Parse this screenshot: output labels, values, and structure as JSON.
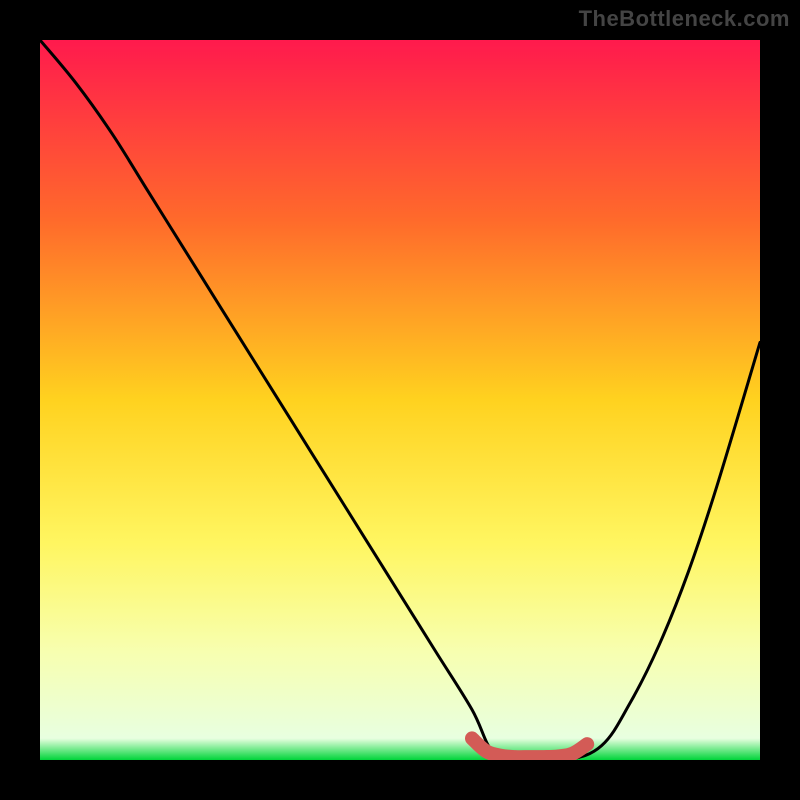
{
  "watermark": "TheBottleneck.com",
  "chart_data": {
    "type": "line",
    "title": "",
    "xlabel": "",
    "ylabel": "",
    "xlim": [
      0,
      100
    ],
    "ylim": [
      0,
      100
    ],
    "grid": false,
    "legend": false,
    "background_gradient_stops": [
      {
        "offset": 0,
        "color": "#ff1a4d"
      },
      {
        "offset": 25,
        "color": "#ff6a2b"
      },
      {
        "offset": 50,
        "color": "#ffd21f"
      },
      {
        "offset": 70,
        "color": "#fff661"
      },
      {
        "offset": 85,
        "color": "#f7ffb0"
      },
      {
        "offset": 97,
        "color": "#e8ffe0"
      },
      {
        "offset": 100,
        "color": "#00d43a"
      }
    ],
    "series": [
      {
        "name": "bottleneck-curve",
        "color": "#000000",
        "x": [
          0,
          5,
          10,
          15,
          20,
          25,
          30,
          35,
          40,
          45,
          50,
          55,
          60,
          63,
          67,
          73,
          78,
          82,
          86,
          90,
          94,
          100
        ],
        "y": [
          100,
          94,
          87,
          79,
          71,
          63,
          55,
          47,
          39,
          31,
          23,
          15,
          7,
          1,
          0,
          0,
          2,
          8,
          16,
          26,
          38,
          58
        ]
      },
      {
        "name": "optimal-range-marker",
        "color": "#d35b56",
        "x": [
          60,
          62,
          64,
          66,
          68,
          70,
          72,
          74,
          76
        ],
        "y": [
          3,
          1.2,
          0.6,
          0.4,
          0.4,
          0.4,
          0.5,
          0.9,
          2.2
        ]
      }
    ],
    "annotations": []
  }
}
